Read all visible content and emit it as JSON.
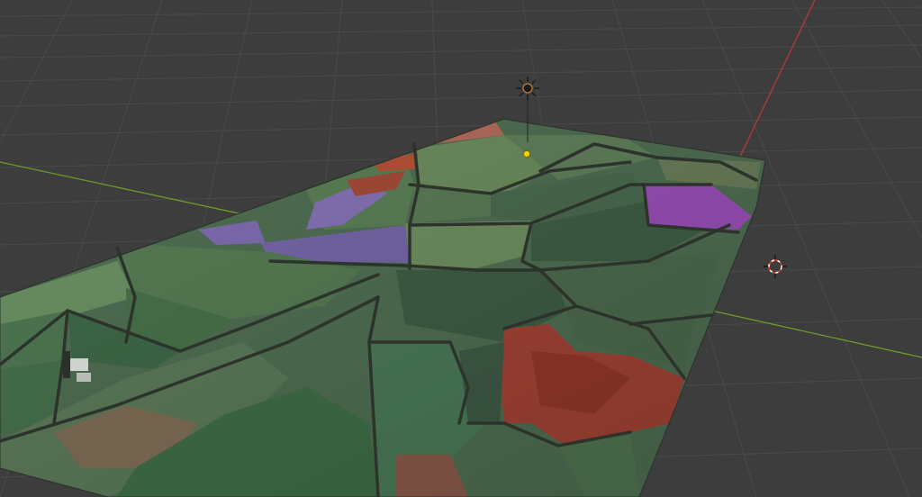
{
  "viewport": {
    "background": "#3d3d3d",
    "grid_color": "#4a4a4a",
    "x_axis_color": "#b33b3b",
    "y_axis_color": "#6f9a2a"
  },
  "objects": [
    {
      "name": "terrain-mesh",
      "kind": "textured terrain"
    },
    {
      "name": "light",
      "kind": "point light",
      "icon": "sun-light-icon"
    },
    {
      "name": "camera-object",
      "kind": "camera marker",
      "icon": "target-icon"
    },
    {
      "name": "origin-point",
      "kind": "object origin",
      "color": "#f5d400"
    }
  ],
  "terrain_colors": {
    "field_green": "#4f6e52",
    "field_dark": "#3b5540",
    "field_light": "#6b8a5e",
    "hedge": "#2c332b",
    "purple": "#7e6bb0",
    "magenta": "#9a4fb8",
    "rust": "#a34335",
    "tan": "#8a6a55"
  }
}
